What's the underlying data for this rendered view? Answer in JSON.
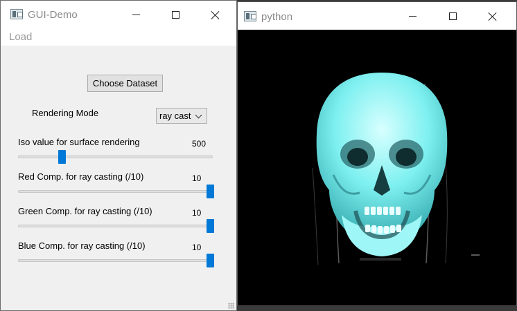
{
  "gui_window": {
    "title": "GUI-Demo",
    "icon": "window-app-icon",
    "menu": {
      "load": "Load"
    },
    "choose_button": "Choose Dataset",
    "rendering_mode": {
      "label": "Rendering Mode",
      "selected": "ray cast"
    },
    "sliders": [
      {
        "label": "Iso value for surface rendering",
        "value": "500",
        "fraction": 0.21
      },
      {
        "label": "Red Comp. for ray casting (/10)",
        "value": "10",
        "fraction": 1.0
      },
      {
        "label": "Green Comp. for ray casting (/10)",
        "value": "10",
        "fraction": 1.0
      },
      {
        "label": "Blue Comp. for ray casting (/10)",
        "value": "10",
        "fraction": 1.0
      }
    ]
  },
  "python_window": {
    "title": "python",
    "icon": "window-app-icon",
    "render_color": "#7ef0f0",
    "background": "#000000"
  },
  "colors": {
    "slider_accent": "#0078d7"
  }
}
